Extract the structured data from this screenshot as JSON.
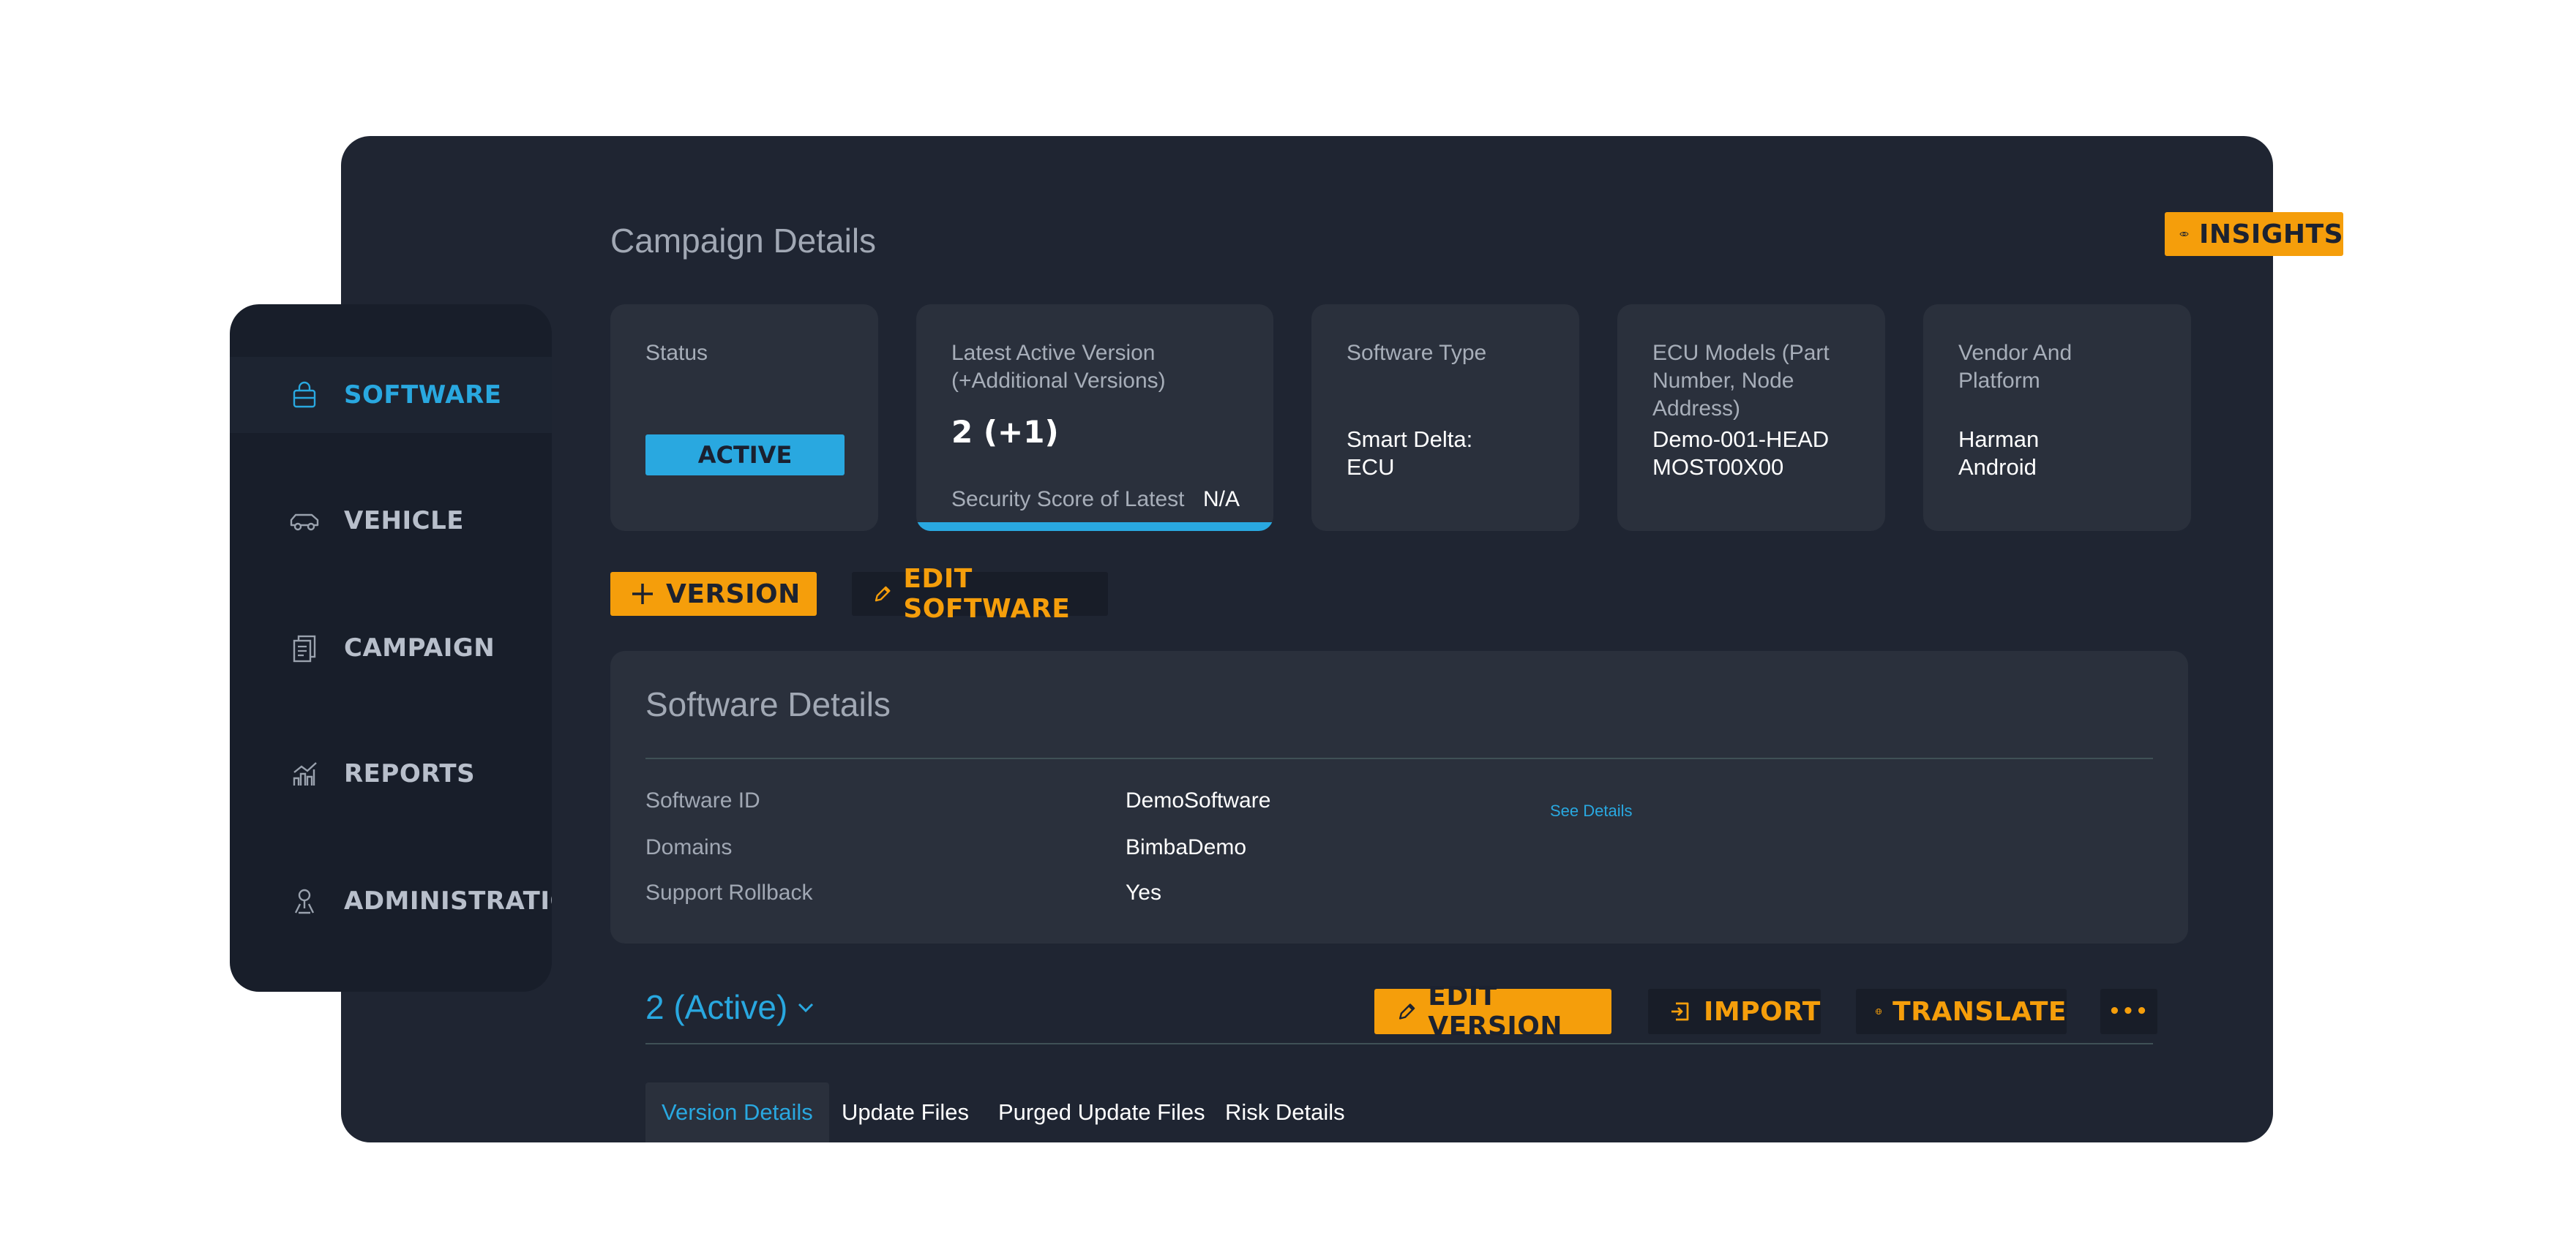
{
  "header": {
    "title": "Campaign Details",
    "insights_label": "INSIGHTS"
  },
  "sidebar": {
    "items": [
      {
        "label": "SOFTWARE",
        "icon": "software-icon",
        "active": true
      },
      {
        "label": "VEHICLE",
        "icon": "vehicle-icon",
        "active": false
      },
      {
        "label": "CAMPAIGN",
        "icon": "campaign-icon",
        "active": false
      },
      {
        "label": "REPORTS",
        "icon": "reports-icon",
        "active": false
      },
      {
        "label": "ADMINISTRATION",
        "icon": "administration-icon",
        "active": false
      }
    ]
  },
  "stats": {
    "status": {
      "label": "Status",
      "value": "ACTIVE"
    },
    "latest_version": {
      "label_line1": "Latest Active Version",
      "label_line2": "(+Additional Versions)",
      "value": "2 (+1)",
      "security_label": "Security Score of Latest",
      "security_value": "N/A"
    },
    "software_type": {
      "label": "Software Type",
      "value_line1": "Smart Delta:",
      "value_line2": "ECU"
    },
    "ecu_models": {
      "label_line1": "ECU Models (Part",
      "label_line2": "Number, Node Address)",
      "value_line1": "Demo-001-HEAD",
      "value_line2": "MOST00X00"
    },
    "vendor": {
      "label_line1": "Vendor And",
      "label_line2": "Platform",
      "value_line1": "Harman",
      "value_line2": "Android"
    }
  },
  "actions": {
    "version_label": "VERSION",
    "edit_software_label": "EDIT SOFTWARE"
  },
  "software_details": {
    "title": "Software Details",
    "rows": [
      {
        "label": "Software ID",
        "value": "DemoSoftware"
      },
      {
        "label": "Domains",
        "value": "BimbaDemo"
      },
      {
        "label": "Support Rollback",
        "value": "Yes"
      }
    ],
    "see_details_label": "See Details"
  },
  "version_section": {
    "selected": "2 (Active)",
    "edit_version_label": "EDIT VERSION",
    "import_label": "IMPORT",
    "translate_label": "TRANSLATE",
    "more_label": "•••"
  },
  "tabs": [
    {
      "label": "Version Details",
      "active": true
    },
    {
      "label": "Update Files",
      "active": false
    },
    {
      "label": "Purged Update Files",
      "active": false
    },
    {
      "label": "Risk Details",
      "active": false
    }
  ],
  "colors": {
    "accent_blue": "#29a8e0",
    "accent_orange": "#f59e0b",
    "panel_bg": "#1f2532",
    "card_bg": "#2a303c",
    "sidebar_bg": "#181e2a"
  }
}
